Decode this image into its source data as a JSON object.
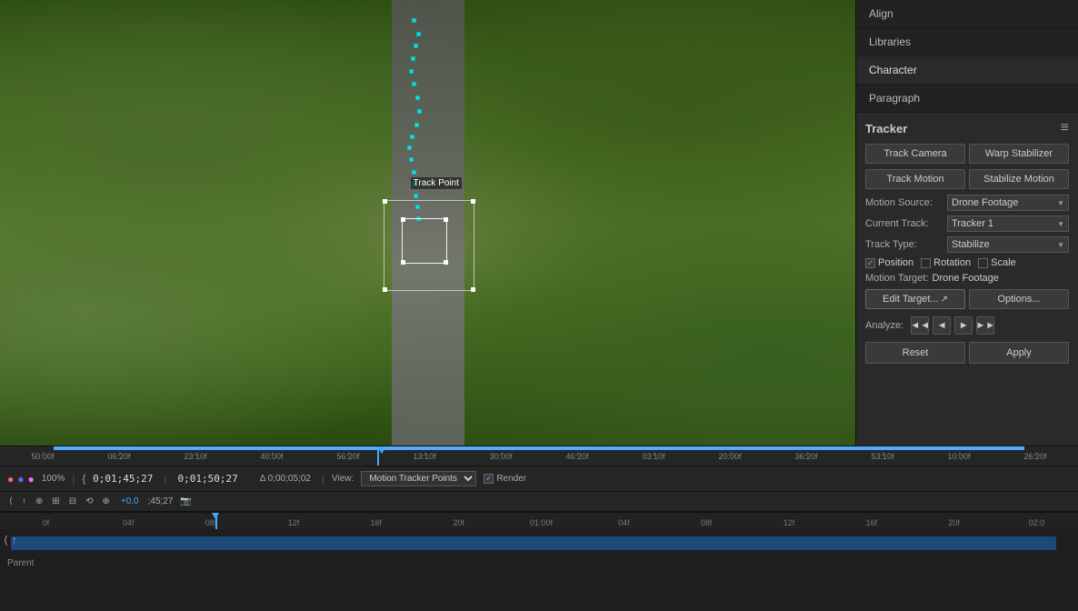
{
  "panel": {
    "tabs": [
      {
        "label": "Align",
        "active": false
      },
      {
        "label": "Libraries",
        "active": false
      },
      {
        "label": "Character",
        "active": true
      },
      {
        "label": "Paragraph",
        "active": false
      }
    ],
    "tracker": {
      "title": "Tracker",
      "buttons": {
        "track_camera": "Track Camera",
        "warp_stabilizer": "Warp Stabilizer",
        "track_motion": "Track Motion",
        "stabilize_motion": "Stabilize Motion"
      },
      "motion_source_label": "Motion Source:",
      "motion_source_value": "Drone Footage",
      "current_track_label": "Current Track:",
      "current_track_value": "Tracker 1",
      "track_type_label": "Track Type:",
      "track_type_value": "Stabilize",
      "checkboxes": {
        "position": {
          "label": "Position",
          "checked": true
        },
        "rotation": {
          "label": "Rotation",
          "checked": false
        },
        "scale": {
          "label": "Scale",
          "checked": false
        }
      },
      "motion_target_label": "Motion Target:",
      "motion_target_value": "Drone Footage",
      "edit_target_btn": "Edit Target...",
      "options_btn": "Options...",
      "analyze_label": "Analyze:",
      "analyze_btns": [
        "◄◄",
        "◄",
        "►",
        "►►"
      ],
      "reset_btn": "Reset",
      "apply_btn": "Apply"
    }
  },
  "timeline": {
    "ruler_marks": [
      "50:00f",
      "06:20f",
      "23:10f",
      "40:00f",
      "56:20f",
      "13:10f",
      "30:00f",
      "46:20f",
      "03:10f",
      "20:00f",
      "36:20f",
      "53:10f",
      "10:00f",
      "26:20f"
    ],
    "controls": {
      "zoom": "100%",
      "timecode_start": "0;01;45;27",
      "timecode_end": "0;01;50;27",
      "timecode_duration": "Δ 0;00;05;02",
      "view_label": "View:",
      "view_value": "Motion Tracker Points",
      "render_label": "Render"
    },
    "toolbar_timecode": "+0.0",
    "current_time": ";45;27",
    "bottom_ruler_marks": [
      "0f",
      "04f",
      "08f",
      "12f",
      "16f",
      "20f",
      "01:00f",
      "04f",
      "08f",
      "12f",
      "16f",
      "20f",
      "02:0"
    ],
    "parent_label": "Parent"
  },
  "video": {
    "track_point_label": "Track Point"
  }
}
